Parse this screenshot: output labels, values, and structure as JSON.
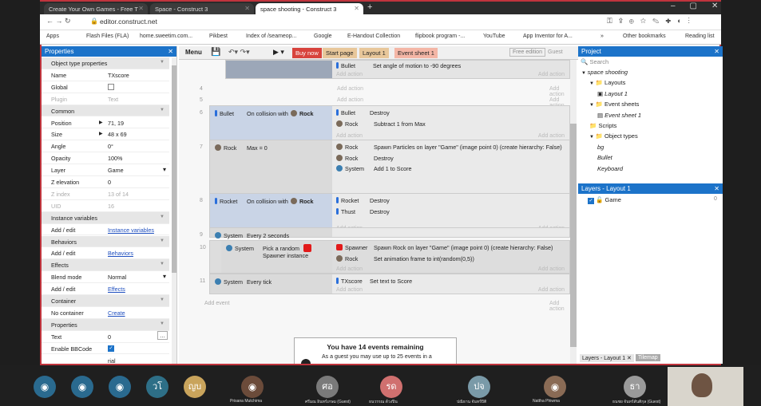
{
  "browser": {
    "tabs": [
      {
        "label": "Create Your Own Games - Free T"
      },
      {
        "label": "Space - Construct 3"
      },
      {
        "label": "space shooting - Construct 3"
      }
    ],
    "url": "editor.construct.net",
    "bookmarks": [
      "Apps",
      "Flash Files (FLA)",
      "home.sweetim.com...",
      "Pikbest",
      "Index of /seameop...",
      "Google",
      "E-Handout Collection",
      "flipbook program -...",
      "YouTube",
      "App Inventor for A...",
      "»",
      "Other bookmarks",
      "Reading list"
    ]
  },
  "properties": {
    "title": "Properties",
    "rows": [
      {
        "k": "Object type properties",
        "v": "",
        "type": "sec"
      },
      {
        "k": "Name",
        "v": "TXscore"
      },
      {
        "k": "Global",
        "v": "",
        "type": "check"
      },
      {
        "k": "Plugin",
        "v": "Text",
        "type": "muted"
      },
      {
        "k": "Common",
        "v": "",
        "type": "sec"
      },
      {
        "k": "Position",
        "v": "71, 19"
      },
      {
        "k": "Size",
        "v": "48 x 69"
      },
      {
        "k": "Angle",
        "v": "0°"
      },
      {
        "k": "Opacity",
        "v": "100%"
      },
      {
        "k": "Layer",
        "v": "Game"
      },
      {
        "k": "Z elevation",
        "v": "0"
      },
      {
        "k": "Z index",
        "v": "13 of 14",
        "type": "muted"
      },
      {
        "k": "UID",
        "v": "16",
        "type": "muted"
      },
      {
        "k": "Instance variables",
        "v": "",
        "type": "sec"
      },
      {
        "k": "Add / edit",
        "v": "Instance variables",
        "type": "link"
      },
      {
        "k": "Behaviors",
        "v": "",
        "type": "sec"
      },
      {
        "k": "Add / edit",
        "v": "Behaviors",
        "type": "link"
      },
      {
        "k": "Effects",
        "v": "",
        "type": "sec"
      },
      {
        "k": "Blend mode",
        "v": "Normal"
      },
      {
        "k": "Add / edit",
        "v": "Effects",
        "type": "link"
      },
      {
        "k": "Container",
        "v": "",
        "type": "sec"
      },
      {
        "k": "No container",
        "v": "Create",
        "type": "link"
      },
      {
        "k": "Properties",
        "v": "",
        "type": "sec"
      },
      {
        "k": "Text",
        "v": "0"
      },
      {
        "k": "Enable BBCode",
        "v": "",
        "type": "checked"
      }
    ],
    "font_value": "rial"
  },
  "toolbar": {
    "menu": "Menu",
    "buy_now": "Buy now",
    "tabs": [
      "Start page",
      "Layout 1",
      "Event sheet 1"
    ],
    "free_edition": "Free edition",
    "guest": "Guest"
  },
  "events": {
    "add_action": "Add action",
    "add_event": "Add event",
    "top_row": {
      "obj": "Bullet",
      "act": "Set  angle of motion to -90 degrees"
    },
    "rows": [
      {
        "num": "6",
        "cobj": "Bullet",
        "cond": "On collision with",
        "cond2": "Rock",
        "acts": [
          [
            "Bullet",
            "Destroy"
          ],
          [
            "Rock",
            "Subtract 1 from Max"
          ]
        ]
      },
      {
        "num": "7",
        "cobj": "Rock",
        "cond": "Max = 0",
        "acts": [
          [
            "Rock",
            "Spawn  Particles on layer \"Game\" (image point 0) (create hierarchy: False)"
          ],
          [
            "Rock",
            "Destroy"
          ],
          [
            "System",
            "Add 1 to Score"
          ]
        ]
      },
      {
        "num": "8",
        "cobj": "Rocket",
        "cond": "On collision with",
        "cond2": "Rock",
        "acts": [
          [
            "Rocket",
            "Destroy"
          ],
          [
            "Thust",
            "Destroy"
          ]
        ]
      },
      {
        "num": "9",
        "cobj": "System",
        "cond": "Every 2 seconds",
        "acts": []
      },
      {
        "num": "10",
        "cobj": "System",
        "cond": "Pick a random  Spawner instance",
        "acts": [
          [
            "Spawner",
            "Spawn  Rock on layer \"Game\" (image point 0) (create hierarchy: False)"
          ],
          [
            "Rock",
            "Set animation frame to int(random(0,5))"
          ]
        ]
      },
      {
        "num": "11",
        "cobj": "System",
        "cond": "Every tick",
        "acts": [
          [
            "TXscore",
            "Set text to Score"
          ]
        ]
      }
    ],
    "nums_empty": [
      "4",
      "5"
    ],
    "notice_title": "You have 14 events remaining",
    "notice_body": "As a guest you may use up to 25 events in a"
  },
  "project": {
    "title": "Project",
    "search_placeholder": "Search",
    "tree": [
      "space shooting",
      "Layouts",
      "Layout 1",
      "Event sheets",
      "Event sheet 1",
      "Scripts",
      "Object types",
      "bg",
      "Bullet",
      "Keyboard"
    ]
  },
  "layers": {
    "title": "Layers - Layout 1",
    "items": [
      {
        "name": "Game",
        "count": "0"
      }
    ],
    "bottom_tabs": [
      "Layers - Layout 1",
      "Tilemap"
    ]
  },
  "meeting": {
    "participants": [
      {
        "initial": "",
        "name": ""
      },
      {
        "initial": "",
        "name": ""
      },
      {
        "initial": "",
        "name": ""
      },
      {
        "initial": "วโ",
        "name": ""
      },
      {
        "initial": "ญบ",
        "name": ""
      },
      {
        "initial": "",
        "name": "Prisana Mutchima"
      },
      {
        "initial": "ศอ",
        "name": "ศรีมณ อินทร์เกษม (Guest)"
      },
      {
        "initial": "รด",
        "name": "ธนวรรณ ด้วงปิน"
      },
      {
        "initial": "ปจ",
        "name": "ปณิธาน จันทร์ปิติ"
      },
      {
        "initial": "",
        "name": "Nattha Phiwma"
      },
      {
        "initial": "ธา",
        "name": "ธนชย จันทร์สันติกุล (Guest)"
      }
    ]
  }
}
